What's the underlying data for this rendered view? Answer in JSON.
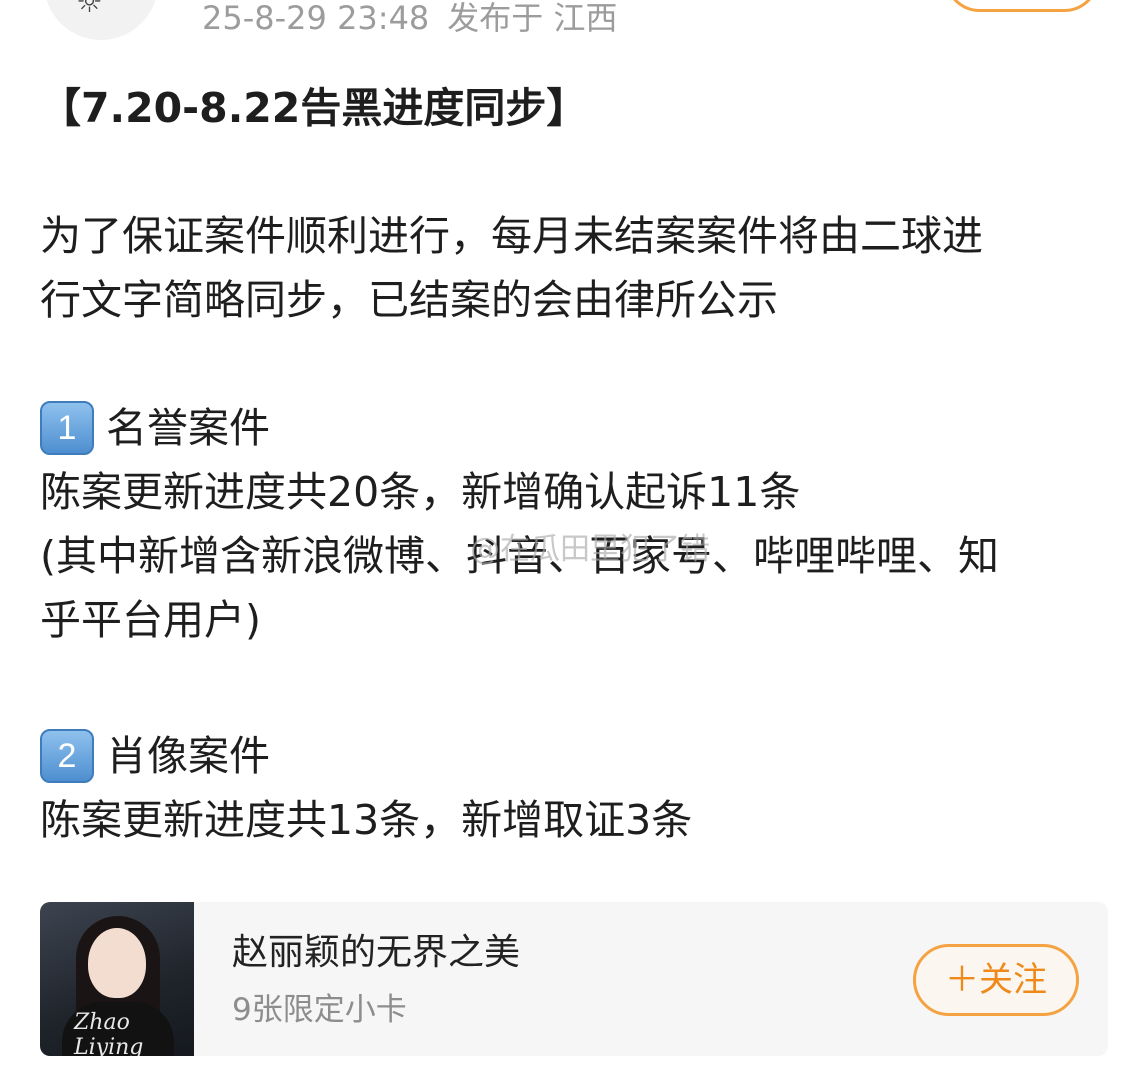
{
  "header": {
    "timestamp": "25-8-29 23:48",
    "location": "发布于 江西"
  },
  "post": {
    "title": "【7.20-8.22告黑进度同步】",
    "intro_line1": "为了保证案件顺利进行，每月未结案案件将由二球进",
    "intro_line2": "行文字简略同步，已结案的会由律所公示",
    "section1": {
      "number": "1",
      "heading": "名誉案件",
      "line1": "陈案更新进度共20条，新增确认起诉11条",
      "line2": "(其中新增含新浪微博、抖音、百家号、哔哩哔哩、知",
      "line3": "乎平台用户)"
    },
    "section2": {
      "number": "2",
      "heading": "肖像案件",
      "line1": "陈案更新进度共13条，新增取证3条"
    }
  },
  "watermark": "@在瓜田里犯了错",
  "card": {
    "cover_text": "Zhao Liying",
    "title": "赵丽颖的无界之美",
    "subtitle": "9张限定小卡",
    "follow_label": "＋关注"
  },
  "colors": {
    "accent": "#f5a342",
    "meta_text": "#9c9c9c",
    "keycap": "#5b9bd8"
  },
  "icons": {
    "avatar": "sun-icon"
  }
}
